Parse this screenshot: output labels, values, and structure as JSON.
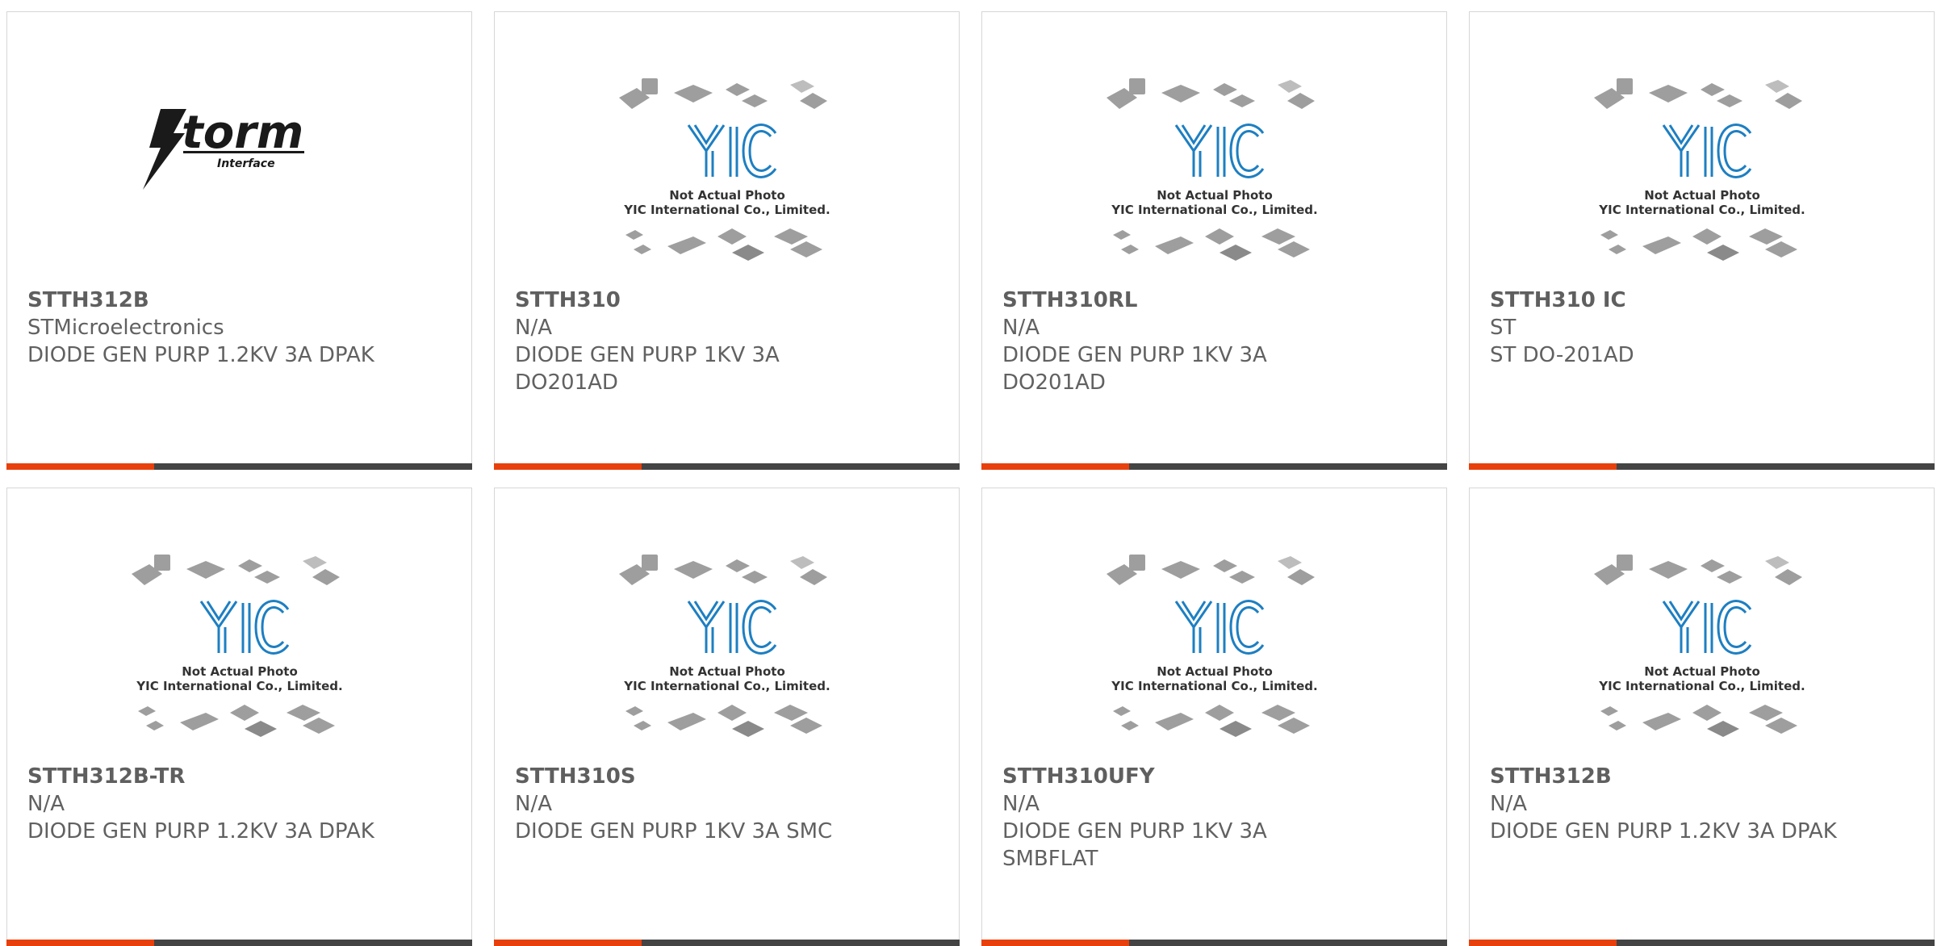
{
  "placeholder": {
    "caption_line1": "Not Actual Photo",
    "caption_line2": "YIC International Co., Limited.",
    "logo_text": "YIC"
  },
  "storm_logo": {
    "word": "torm",
    "sub": "Interface"
  },
  "colors": {
    "accent": "#e8400c",
    "bar": "#444444",
    "text": "#616161",
    "yic_blue": "#1d7fc2"
  },
  "products": [
    {
      "part": "STTH312B",
      "manufacturer": "STMicroelectronics",
      "desc": "DIODE GEN PURP 1.2KV 3A DPAK",
      "desc2": "",
      "image": "storm-logo"
    },
    {
      "part": "STTH310",
      "manufacturer": "N/A",
      "desc": "DIODE GEN PURP 1KV 3A",
      "desc2": "DO201AD",
      "image": "yic-placeholder"
    },
    {
      "part": "STTH310RL",
      "manufacturer": "N/A",
      "desc": "DIODE GEN PURP 1KV 3A",
      "desc2": "DO201AD",
      "image": "yic-placeholder"
    },
    {
      "part": "STTH310 IC",
      "manufacturer": "ST",
      "desc": "ST DO-201AD",
      "desc2": "",
      "image": "yic-placeholder"
    },
    {
      "part": "STTH312B-TR",
      "manufacturer": "N/A",
      "desc": "DIODE GEN PURP 1.2KV 3A DPAK",
      "desc2": "",
      "image": "yic-placeholder"
    },
    {
      "part": "STTH310S",
      "manufacturer": "N/A",
      "desc": "DIODE GEN PURP 1KV 3A SMC",
      "desc2": "",
      "image": "yic-placeholder"
    },
    {
      "part": "STTH310UFY",
      "manufacturer": "N/A",
      "desc": "DIODE GEN PURP 1KV 3A",
      "desc2": "SMBFLAT",
      "image": "yic-placeholder"
    },
    {
      "part": "STTH312B",
      "manufacturer": "N/A",
      "desc": "DIODE GEN PURP 1.2KV 3A DPAK",
      "desc2": "",
      "image": "yic-placeholder"
    }
  ]
}
